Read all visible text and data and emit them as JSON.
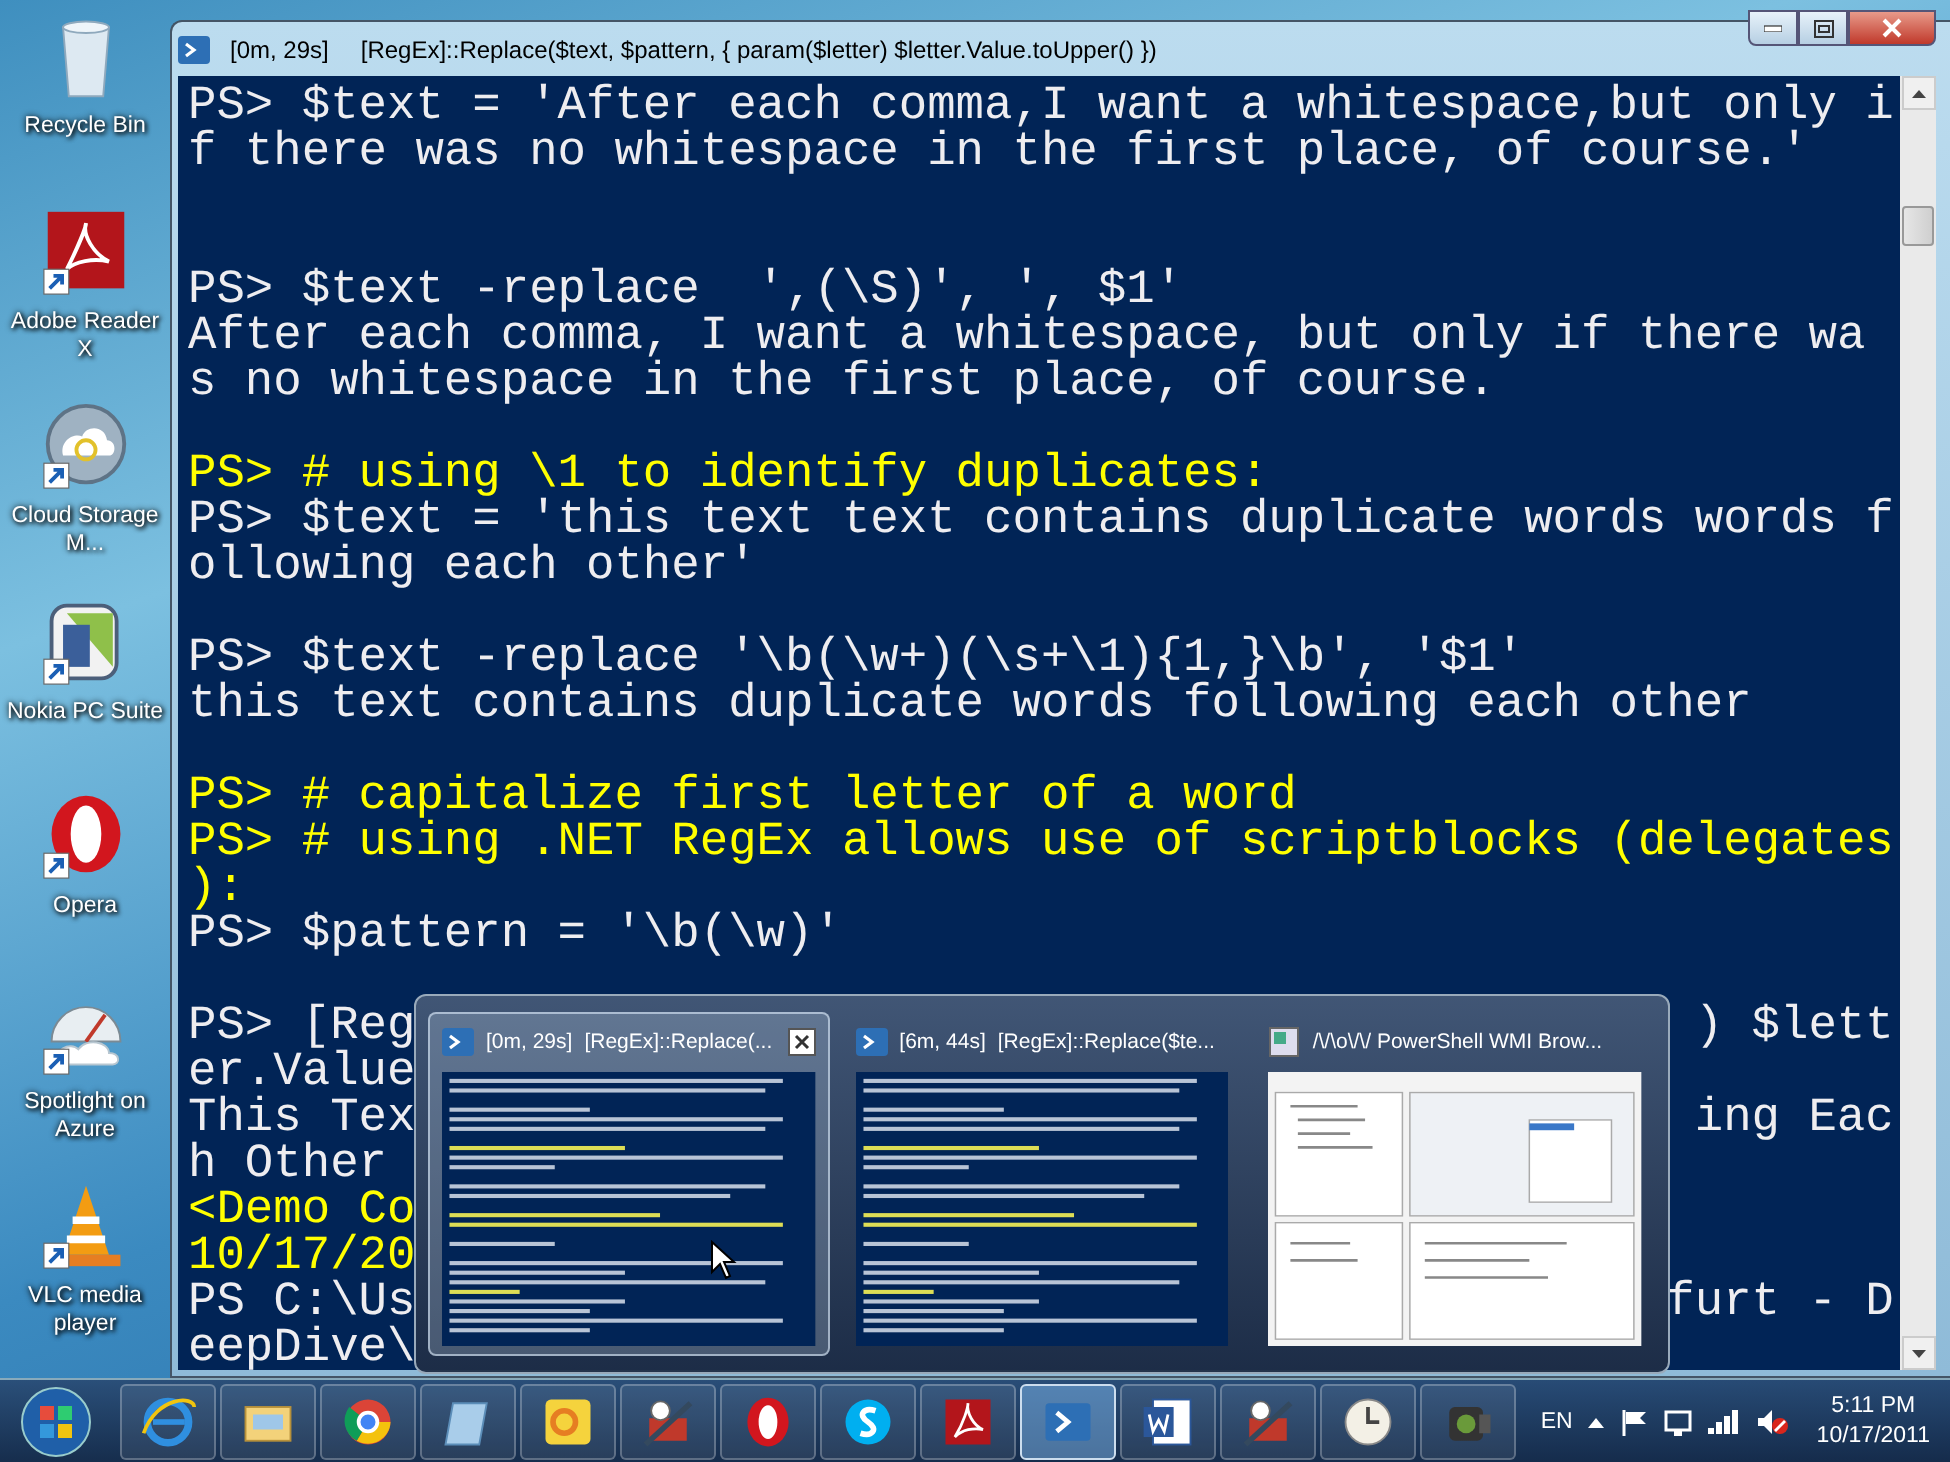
{
  "desktop_icons": [
    {
      "label": "Recycle Bin"
    },
    {
      "label": "Adobe Reader X"
    },
    {
      "label": "Cloud Storage M..."
    },
    {
      "label": "Nokia PC Suite"
    },
    {
      "label": "Opera"
    },
    {
      "label": "Spotlight on Azure"
    },
    {
      "label": "VLC media player"
    }
  ],
  "console_window": {
    "elapsed": "[0m, 29s]",
    "title": "[RegEx]::Replace($text, $pattern, { param($letter) $letter.Value.toUpper() })",
    "lines": [
      {
        "kind": "text",
        "text": "PS> $text = 'After each comma,I want a whitespace,but only i",
        "color": "#eeedf0"
      },
      {
        "kind": "text",
        "text": "f there was no whitespace in the first place, of course.'",
        "color": "#eeedf0"
      },
      {
        "kind": "blank"
      },
      {
        "kind": "blank"
      },
      {
        "kind": "text",
        "text": "PS> $text -replace  ',(\\S)', ', $1'",
        "color": "#eeedf0"
      },
      {
        "kind": "text",
        "text": "After each comma, I want a whitespace, but only if there wa",
        "color": "#eeedf0"
      },
      {
        "kind": "text",
        "text": "s no whitespace in the first place, of course.",
        "color": "#eeedf0"
      },
      {
        "kind": "blank"
      },
      {
        "kind": "text",
        "text": "PS> # using \\1 to identify duplicates:",
        "color": "#ffff00"
      },
      {
        "kind": "text",
        "text": "PS> $text = 'this text text contains duplicate words words f",
        "color": "#eeedf0"
      },
      {
        "kind": "text",
        "text": "ollowing each other'",
        "color": "#eeedf0"
      },
      {
        "kind": "blank"
      },
      {
        "kind": "text",
        "text": "PS> $text -replace '\\b(\\w+)(\\s+\\1){1,}\\b', '$1'",
        "color": "#eeedf0"
      },
      {
        "kind": "text",
        "text": "this text contains duplicate words following each other",
        "color": "#eeedf0"
      },
      {
        "kind": "blank"
      },
      {
        "kind": "text",
        "text": "PS> # capitalize first letter of a word",
        "color": "#ffff00"
      },
      {
        "kind": "text",
        "text": "PS> # using .NET RegEx allows use of scriptblocks (delegates",
        "color": "#ffff00"
      },
      {
        "kind": "text",
        "text": "):",
        "color": "#ffff00"
      },
      {
        "kind": "text",
        "text": "PS> $pattern = '\\b(\\w)'",
        "color": "#eeedf0"
      },
      {
        "kind": "blank"
      },
      {
        "kind": "text",
        "text": "PS> [Reg",
        "text_right": ") $lett",
        "color": "#eeedf0"
      },
      {
        "kind": "text",
        "text": "er.Value",
        "color": "#eeedf0"
      },
      {
        "kind": "text",
        "text": "This Tex",
        "text_right": "ing Eac",
        "color": "#eeedf0"
      },
      {
        "kind": "text",
        "text": "h Other",
        "color": "#eeedf0"
      },
      {
        "kind": "text",
        "text": "<Demo Co",
        "color": "#ffff00"
      },
      {
        "kind": "text",
        "text": "10/17/20",
        "color": "#ffff00"
      },
      {
        "kind": "text",
        "text": "PS C:\\Us",
        "text_right": "furt - D",
        "color": "#eeedf0"
      },
      {
        "kind": "text",
        "text": "eepDive\\",
        "color": "#eeedf0"
      }
    ]
  },
  "thumbnails": [
    {
      "kind": "console",
      "elapsed": "[0m, 29s]",
      "title": "[RegEx]::Replace(...",
      "selected": true
    },
    {
      "kind": "console",
      "elapsed": "[6m, 44s]",
      "title": "[RegEx]::Replace($te...",
      "selected": false
    },
    {
      "kind": "app",
      "title": "/\\/\\o\\/\\/ PowerShell WMI Brow...",
      "selected": false
    }
  ],
  "taskbar": {
    "buttons": [
      {
        "selected": false
      },
      {
        "selected": false
      },
      {
        "selected": false
      },
      {
        "selected": false
      },
      {
        "selected": false
      },
      {
        "selected": false
      },
      {
        "selected": false
      },
      {
        "selected": false
      },
      {
        "selected": false
      },
      {
        "selected": true
      },
      {
        "selected": false
      },
      {
        "selected": false
      },
      {
        "selected": false
      },
      {
        "selected": false
      }
    ],
    "language": "EN",
    "time": "5:11 PM",
    "date": "10/17/2011"
  }
}
